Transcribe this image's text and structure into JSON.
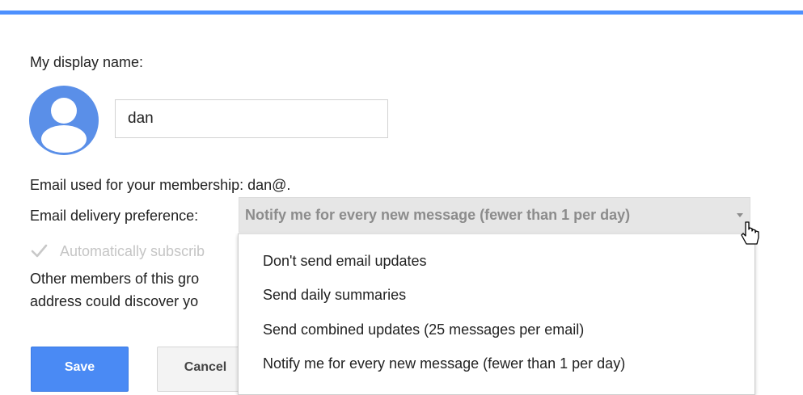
{
  "colors": {
    "accent": "#4d90fe",
    "save_button": "#4a8af4",
    "avatar": "#5a8fe8"
  },
  "profile": {
    "display_name_label": "My display name:",
    "display_name_value": "dan",
    "avatar_icon": "person-icon"
  },
  "membership": {
    "email_label": "Email used for your membership: dan@."
  },
  "delivery": {
    "label": "Email delivery preference:",
    "selected": "Notify me for every new message (fewer than 1 per day)",
    "options": [
      "Don't send email updates",
      "Send daily summaries",
      "Send combined updates (25 messages per email)",
      "Notify me for every new message (fewer than 1 per day)"
    ]
  },
  "auto_subscribe": {
    "checked": true,
    "label": "Automatically subscrib"
  },
  "privacy_note": {
    "line1": "Other members of this gro",
    "line2": "address could discover yo"
  },
  "buttons": {
    "save": "Save",
    "cancel": "Cancel"
  }
}
